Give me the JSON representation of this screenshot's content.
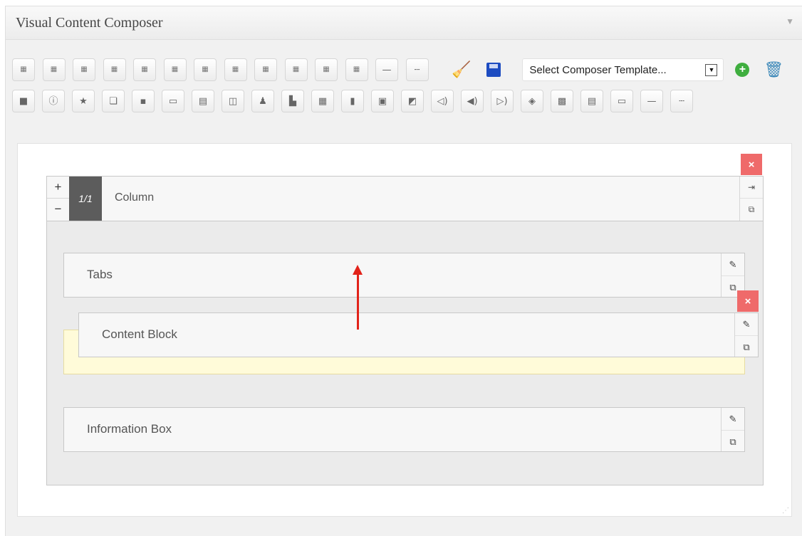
{
  "panel": {
    "title": "Visual Content Composer",
    "toggle_icon": "triangle-down-icon"
  },
  "toolbar": {
    "row1_buttons": [
      {
        "name": "layout-1-col-icon",
        "glyph": "▦"
      },
      {
        "name": "layout-2-col-icon",
        "glyph": "▦"
      },
      {
        "name": "layout-3-col-icon",
        "glyph": "▦"
      },
      {
        "name": "layout-4-col-icon",
        "glyph": "▦"
      },
      {
        "name": "layout-5-col-icon",
        "glyph": "▦"
      },
      {
        "name": "layout-6-col-icon",
        "glyph": "▦"
      },
      {
        "name": "layout-7-col-icon",
        "glyph": "▦"
      },
      {
        "name": "layout-8-col-icon",
        "glyph": "▦"
      },
      {
        "name": "layout-9-col-icon",
        "glyph": "▦"
      },
      {
        "name": "layout-10-col-icon",
        "glyph": "▦"
      },
      {
        "name": "layout-11-col-icon",
        "glyph": "▦"
      },
      {
        "name": "layout-12-col-icon",
        "glyph": "▦"
      },
      {
        "name": "divider-solid-icon",
        "glyph": "—"
      },
      {
        "name": "divider-dashed-icon",
        "glyph": "┄"
      }
    ],
    "row2_buttons": [
      {
        "name": "text-block-icon",
        "glyph": "■"
      },
      {
        "name": "info-icon",
        "glyph": "ⓘ"
      },
      {
        "name": "star-icon",
        "glyph": "★"
      },
      {
        "name": "stack-icon",
        "glyph": "❏"
      },
      {
        "name": "media-icon",
        "glyph": "▪"
      },
      {
        "name": "widget-icon",
        "glyph": "▭"
      },
      {
        "name": "panel-icon",
        "glyph": "▤"
      },
      {
        "name": "sidebar-icon",
        "glyph": "◫"
      },
      {
        "name": "user-icon",
        "glyph": "♟"
      },
      {
        "name": "align-icon",
        "glyph": "▙"
      },
      {
        "name": "table-icon",
        "glyph": "▦"
      },
      {
        "name": "document-icon",
        "glyph": "▮"
      },
      {
        "name": "window-icon",
        "glyph": "▣"
      },
      {
        "name": "edit-box-icon",
        "glyph": "◩"
      },
      {
        "name": "audio-left-icon",
        "glyph": "◁)"
      },
      {
        "name": "audio-icon",
        "glyph": "◀)"
      },
      {
        "name": "audio-right-icon",
        "glyph": "▷)"
      },
      {
        "name": "gallery-icon",
        "glyph": "◈"
      },
      {
        "name": "image-icon",
        "glyph": "▩"
      },
      {
        "name": "list-icon",
        "glyph": "▤"
      },
      {
        "name": "settings-box-icon",
        "glyph": "▭"
      },
      {
        "name": "divider-solid-icon",
        "glyph": "—"
      },
      {
        "name": "divider-dashed-icon",
        "glyph": "┄"
      }
    ],
    "template_select": "Select Composer Template...",
    "select_arrow": "▼",
    "add_label": "+",
    "broom_glyph": "🧹",
    "trash_glyph": "🗑"
  },
  "column": {
    "plus": "+",
    "minus": "−",
    "width_label": "1/1",
    "label": "Column",
    "delete": "×",
    "push_icon_glyph": "⇥",
    "clone_icon_glyph": "⧉"
  },
  "blocks": {
    "tabs": {
      "label": "Tabs",
      "edit_glyph": "✎",
      "clone_glyph": "⧉"
    },
    "content_block": {
      "label": "Content Block",
      "delete": "×",
      "edit_glyph": "✎",
      "clone_glyph": "⧉"
    },
    "information_box": {
      "label": "Information Box",
      "edit_glyph": "✎",
      "clone_glyph": "⧉"
    }
  },
  "colors": {
    "delete_red": "#ef6a6a",
    "arrow_red": "#e2231a",
    "dropzone_yellow": "#fffbd9",
    "column_width_badge": "#5c5c5c"
  }
}
